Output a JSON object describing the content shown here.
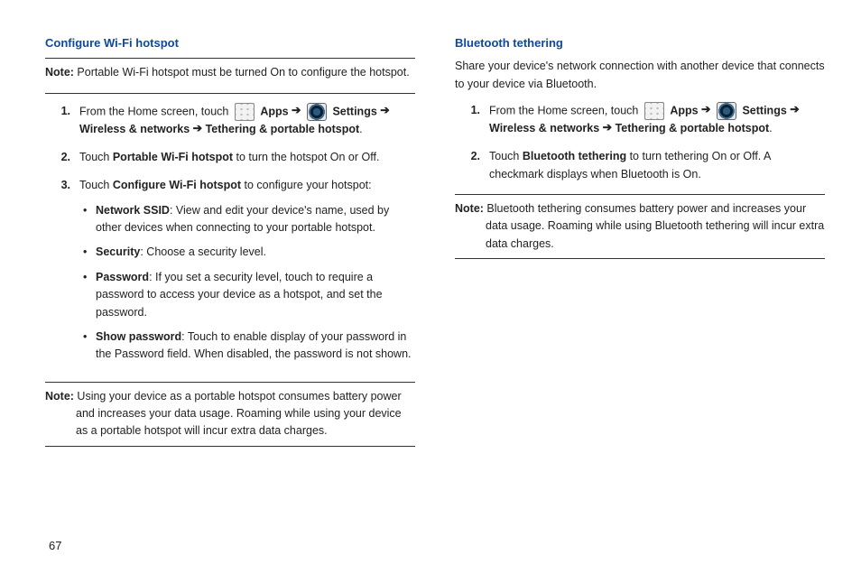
{
  "page_number": "67",
  "left": {
    "title": "Configure Wi-Fi hotspot",
    "note1_label": "Note:",
    "note1_text": " Portable Wi-Fi hotspot must be turned On to configure the hotspot.",
    "steps": [
      {
        "num": "1.",
        "pre": "From the Home screen, touch ",
        "apps": "Apps",
        "arrow1": "  ➔",
        "settings": " Settings",
        "arrow2": " ➔ ",
        "wireless": "Wireless & networks",
        "arrow3": " ➔ ",
        "tether": "Tethering & portable hotspot",
        "post": "."
      },
      {
        "num": "2.",
        "pre": "Touch ",
        "bold": "Portable Wi-Fi hotspot",
        "post": " to turn the hotspot On or Off."
      },
      {
        "num": "3.",
        "pre": "Touch ",
        "bold": "Configure Wi-Fi hotspot",
        "post": " to configure your hotspot:"
      }
    ],
    "bullets": [
      {
        "bold": "Network SSID",
        "rest": ": View and edit your device's name, used by other devices when connecting to your portable hotspot."
      },
      {
        "bold": "Security",
        "rest": ": Choose a security level."
      },
      {
        "bold": "Password",
        "rest": ": If you set a security level, touch to require a password to access your device as a hotspot, and set the password."
      },
      {
        "bold": "Show password",
        "rest": ": Touch to enable display of your password in the Password field. When disabled, the password is not shown."
      }
    ],
    "note2_label": "Note:",
    "note2_text": " Using your device as a portable hotspot consumes battery power and increases your data usage. Roaming while using your device as a portable hotspot will incur extra data charges."
  },
  "right": {
    "title": "Bluetooth tethering",
    "intro": "Share your device's network connection with another device that connects to your device via Bluetooth.",
    "steps": [
      {
        "num": "1.",
        "pre": "From the Home screen, touch ",
        "apps": "Apps",
        "arrow1": "  ➔",
        "settings": " Settings",
        "arrow2": " ➔ ",
        "wireless": "Wireless & networks",
        "arrow3": " ➔ ",
        "tether": "Tethering & portable hotspot",
        "post": "."
      },
      {
        "num": "2.",
        "pre": "Touch ",
        "bold": "Bluetooth tethering",
        "post": " to turn tethering On or Off. A checkmark displays when Bluetooth is On."
      }
    ],
    "note_label": "Note:",
    "note_text": " Bluetooth tethering consumes battery power and increases your data usage. Roaming while using Bluetooth tethering will incur extra data charges."
  }
}
